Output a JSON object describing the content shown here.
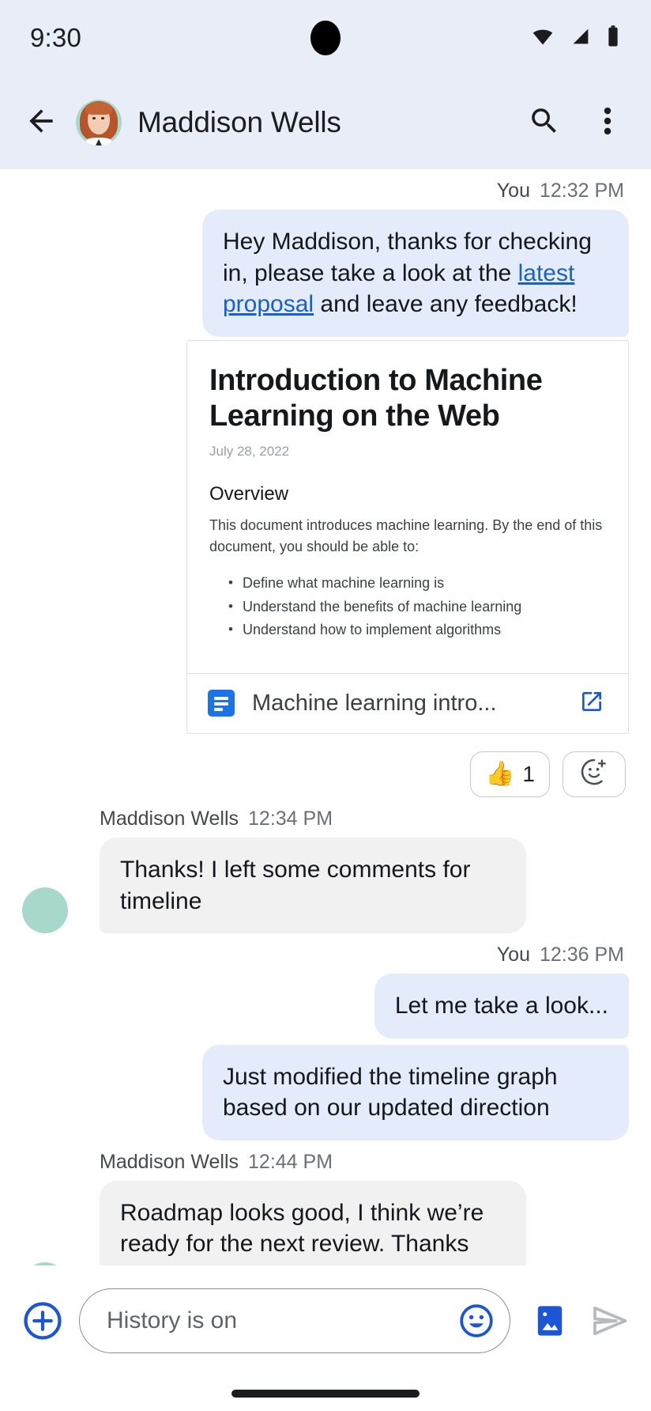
{
  "status_bar": {
    "time": "9:30",
    "icons": [
      "wifi-icon",
      "cellular-signal-icon",
      "battery-icon"
    ]
  },
  "app_bar": {
    "back_icon": "back-arrow-icon",
    "contact_name": "Maddison Wells",
    "search_icon": "search-icon",
    "overflow_icon": "more-vert-icon"
  },
  "messages": [
    {
      "id": "m1",
      "sender": "You",
      "time": "12:32 PM",
      "outgoing": true,
      "text_before_link": "Hey Maddison, thanks for checking in, please take a look at the ",
      "link_text": "latest proposal",
      "text_after_link": " and leave any feedback!"
    },
    {
      "id": "m2",
      "sender": "Maddison Wells",
      "time": "12:34 PM",
      "outgoing": false,
      "text": "Thanks! I left some comments for timeline"
    },
    {
      "id": "m3",
      "sender": "You",
      "time": "12:36 PM",
      "outgoing": true,
      "text": "Let me take a look..."
    },
    {
      "id": "m4",
      "sender": "You",
      "time": "",
      "outgoing": true,
      "text": "Just modified the timeline graph based on our updated direction"
    },
    {
      "id": "m5",
      "sender": "Maddison Wells",
      "time": "12:44 PM",
      "outgoing": false,
      "text": "Roadmap looks good, I think we’re ready for the next review. Thanks Ann!"
    }
  ],
  "doc_card": {
    "title": "Introduction to Machine Learning on the Web",
    "date": "July 28, 2022",
    "section_heading": "Overview",
    "paragraph": "This document introduces machine learning. By the end of this document, you should be able to:",
    "bullets": [
      "Define what machine learning is",
      "Understand the benefits of machine learning",
      "Understand how to implement algorithms"
    ],
    "file_icon": "google-docs-icon",
    "filename": "Machine learning intro...",
    "open_icon": "open-in-new-icon"
  },
  "reactions": {
    "thumbs_up_emoji": "👍",
    "thumbs_up_count": "1",
    "add_reaction_icon": "add-emoji-icon"
  },
  "composer": {
    "plus_icon": "add-circle-icon",
    "placeholder": "History is on",
    "emoji_icon": "emoji-face-icon",
    "gallery_icon": "image-icon",
    "send_icon": "send-icon"
  },
  "colors": {
    "header_bg": "#e8edf7",
    "outgoing_bubble": "#e4ecfb",
    "incoming_bubble": "#f1f1f1",
    "link": "#1a5fd0",
    "accent_blue": "#1a56d6",
    "docs_blue": "#1a73e8"
  }
}
